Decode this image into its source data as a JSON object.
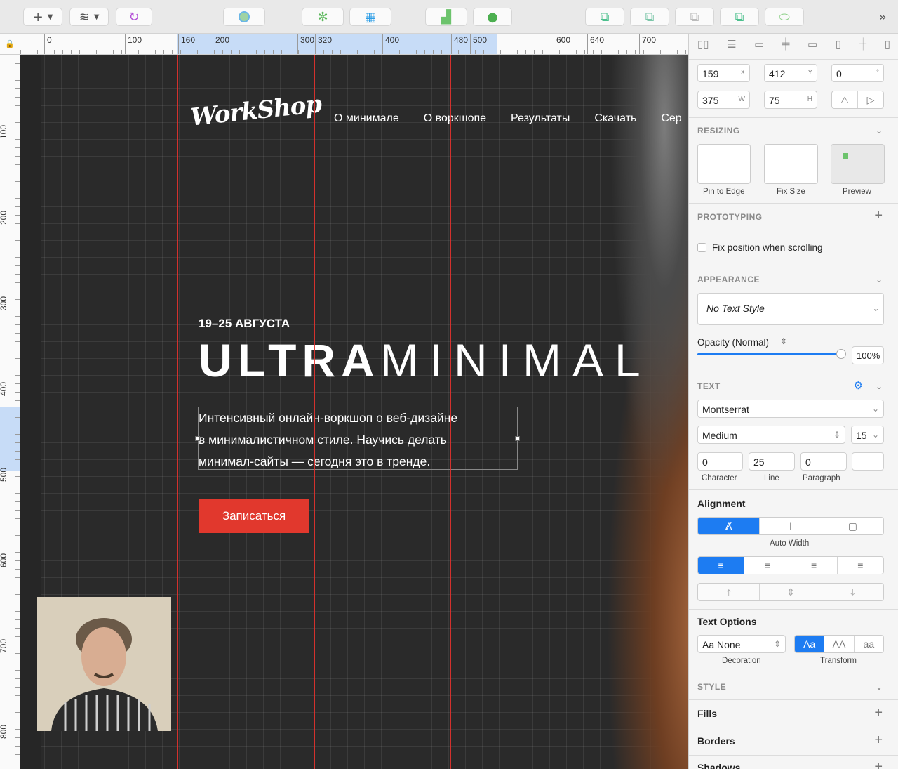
{
  "toolbar": {
    "insert": "+",
    "layers_icon": "layers-icon",
    "sync_icon": "sync-icon",
    "more": "»"
  },
  "ruler": {
    "h_labels": [
      "0",
      "100",
      "160",
      "200",
      "300",
      "320",
      "400",
      "480",
      "500",
      "600",
      "640",
      "700"
    ],
    "v_labels": [
      "100",
      "200",
      "300",
      "400",
      "500",
      "600",
      "700",
      "800"
    ]
  },
  "page": {
    "logo": "WorkShop",
    "nav": [
      "О минимале",
      "О воркшопе",
      "Результаты",
      "Скачать",
      "Сер"
    ],
    "date": "19–25 АВГУСТА",
    "headline_bold": "ULTRA",
    "headline_light": "MINIMAL",
    "description": "Интенсивный онлайн-воркшоп о веб-дизайне\nв минималистичном стиле. Научись делать\nминимал-сайты — сегодня это в тренде.",
    "cta": "Записаться"
  },
  "inspector": {
    "x": "159",
    "x_label": "X",
    "y": "412",
    "y_label": "Y",
    "rotation": "0",
    "rotation_unit": "°",
    "w": "375",
    "w_label": "W",
    "h": "75",
    "h_label": "H",
    "resizing": {
      "title": "RESIZING",
      "pin": "Pin to Edge",
      "fix": "Fix Size",
      "preview": "Preview"
    },
    "prototyping": {
      "title": "PROTOTYPING",
      "fix_pos": "Fix position when scrolling"
    },
    "appearance": {
      "title": "APPEARANCE",
      "style": "No Text Style",
      "opacity_label": "Opacity (Normal)",
      "opacity": "100%",
      "opacity_value": 1.0
    },
    "text": {
      "title": "TEXT",
      "font": "Montserrat",
      "weight": "Medium",
      "size": "15",
      "character": "0",
      "line": "25",
      "paragraph": "0",
      "character_label": "Character",
      "line_label": "Line",
      "paragraph_label": "Paragraph"
    },
    "alignment": {
      "title": "Alignment",
      "auto_width": "Auto Width"
    },
    "text_options": {
      "title": "Text Options",
      "decoration": "Aa None",
      "decoration_label": "Decoration",
      "transform_label": "Transform",
      "transform": [
        "Aa",
        "AA",
        "aa"
      ]
    },
    "style": {
      "title": "STYLE",
      "fills": "Fills",
      "borders": "Borders",
      "shadows": "Shadows"
    }
  },
  "colors": {
    "accent": "#1d7cf2",
    "cta": "#e1382d",
    "guide": "#e5322d"
  }
}
